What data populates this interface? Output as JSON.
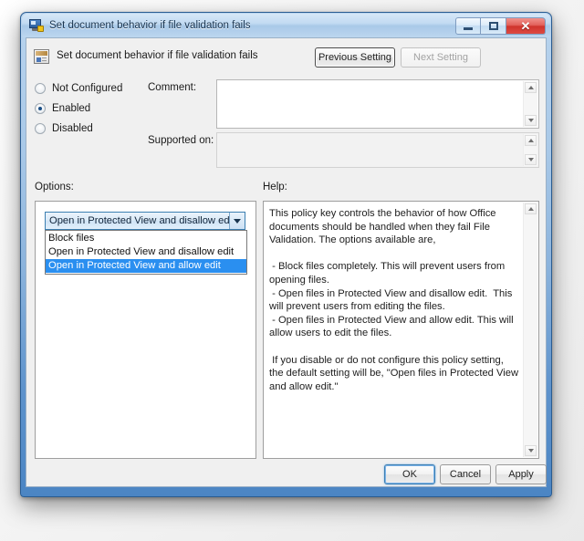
{
  "window": {
    "title": "Set document behavior if file validation fails",
    "title_icon": "policy-monitor-icon",
    "minimize_label": "",
    "maximize_label": "",
    "close_label": "✕"
  },
  "header": {
    "icon": "policy-document-icon",
    "policy_title": "Set document behavior if file validation fails",
    "previous_setting_label": "Previous Setting",
    "next_setting_label": "Next Setting"
  },
  "state": {
    "radios": [
      {
        "label": "Not Configured",
        "checked": false
      },
      {
        "label": "Enabled",
        "checked": true
      },
      {
        "label": "Disabled",
        "checked": false
      }
    ],
    "comment_label": "Comment:",
    "comment_value": "",
    "supported_on_label": "Supported on:",
    "supported_on_value": ""
  },
  "options": {
    "section_label": "Options:",
    "combo_value": "Open in Protected View and disallow edit",
    "dropdown_open": true,
    "dropdown_items": [
      {
        "label": "Block files",
        "selected": false
      },
      {
        "label": "Open in Protected View and disallow edit",
        "selected": false
      },
      {
        "label": "Open in Protected View and allow edit",
        "selected": true
      }
    ]
  },
  "help": {
    "section_label": "Help:",
    "text": "This policy key controls the behavior of how Office documents should be handled when they fail File Validation. The options available are,\n\n - Block files completely. This will prevent users from opening files.\n - Open files in Protected View and disallow edit.  This will prevent users from editing the files.\n - Open files in Protected View and allow edit. This will allow users to edit the files.\n\n If you disable or do not configure this policy setting, the default setting will be, \"Open files in Protected View and allow edit.\""
  },
  "footer": {
    "ok_label": "OK",
    "cancel_label": "Cancel",
    "apply_label": "Apply"
  },
  "colors": {
    "accent": "#2a8ff0",
    "frame": "#5e93cc",
    "close": "#cf342d",
    "focus": "#3c7fb1"
  }
}
